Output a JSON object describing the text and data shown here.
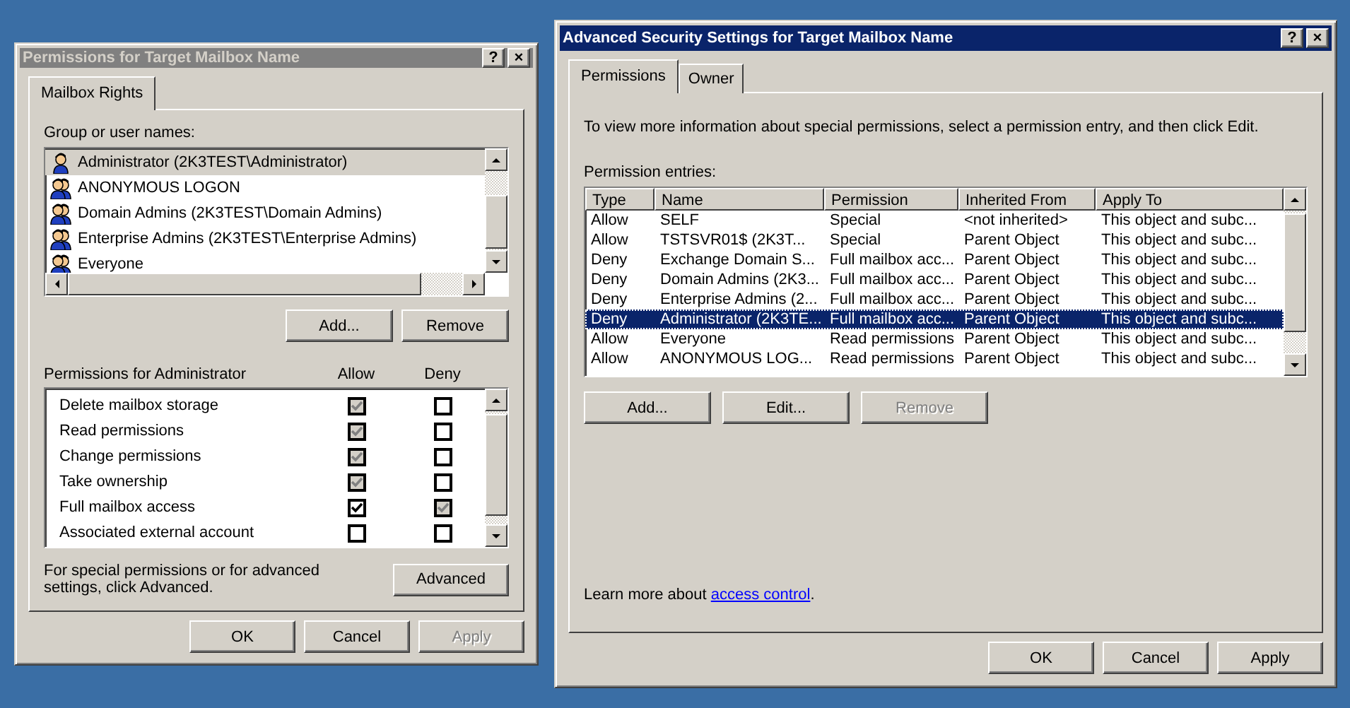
{
  "permissions_window": {
    "title": "Permissions for Target Mailbox Name",
    "active": false,
    "title_buttons": [
      "?",
      "×"
    ],
    "tabs": [
      {
        "label": "Mailbox Rights",
        "selected": true
      }
    ],
    "group_label": "Group or user names:",
    "users": [
      {
        "name": "Administrator (2K3TEST\\Administrator)",
        "kind": "user",
        "selected": true
      },
      {
        "name": "ANONYMOUS LOGON",
        "kind": "group",
        "selected": false
      },
      {
        "name": "Domain Admins (2K3TEST\\Domain Admins)",
        "kind": "group",
        "selected": false
      },
      {
        "name": "Enterprise Admins (2K3TEST\\Enterprise Admins)",
        "kind": "group",
        "selected": false
      },
      {
        "name": "Everyone",
        "kind": "group",
        "selected": false
      }
    ],
    "user_buttons": [
      {
        "label": "Add...",
        "disabled": false
      },
      {
        "label": "Remove",
        "disabled": false
      }
    ],
    "permissions_label": "Permissions for Administrator",
    "allow_header": "Allow",
    "deny_header": "Deny",
    "permissions": [
      {
        "name": "Delete mailbox storage",
        "allow": {
          "checked": true,
          "disabled": true
        },
        "deny": {
          "checked": false,
          "disabled": false
        }
      },
      {
        "name": "Read permissions",
        "allow": {
          "checked": true,
          "disabled": true
        },
        "deny": {
          "checked": false,
          "disabled": false
        }
      },
      {
        "name": "Change permissions",
        "allow": {
          "checked": true,
          "disabled": true
        },
        "deny": {
          "checked": false,
          "disabled": false
        }
      },
      {
        "name": "Take ownership",
        "allow": {
          "checked": true,
          "disabled": true
        },
        "deny": {
          "checked": false,
          "disabled": false
        }
      },
      {
        "name": "Full mailbox access",
        "allow": {
          "checked": true,
          "disabled": false
        },
        "deny": {
          "checked": true,
          "disabled": true
        }
      },
      {
        "name": "Associated external account",
        "allow": {
          "checked": false,
          "disabled": false
        },
        "deny": {
          "checked": false,
          "disabled": false
        }
      }
    ],
    "advanced_hint": "For special permissions or for advanced settings, click Advanced.",
    "advanced_button": "Advanced",
    "buttons": [
      {
        "label": "OK",
        "disabled": false
      },
      {
        "label": "Cancel",
        "disabled": false
      },
      {
        "label": "Apply",
        "disabled": true
      }
    ]
  },
  "advanced_window": {
    "title": "Advanced Security Settings for Target Mailbox Name",
    "active": true,
    "title_buttons": [
      "?",
      "×"
    ],
    "tabs": [
      {
        "label": "Permissions",
        "selected": true
      },
      {
        "label": "Owner",
        "selected": false
      }
    ],
    "intro": "To view more information about special permissions, select a permission entry, and then click Edit.",
    "entries_label": "Permission entries:",
    "columns": [
      "Type",
      "Name",
      "Permission",
      "Inherited From",
      "Apply To"
    ],
    "rows": [
      {
        "cells": [
          "Allow",
          "SELF",
          "Special",
          "<not inherited>",
          "This object and subc..."
        ],
        "selected": false
      },
      {
        "cells": [
          "Allow",
          "TSTSVR01$ (2K3T...",
          "Special",
          "Parent Object",
          "This object and subc..."
        ],
        "selected": false
      },
      {
        "cells": [
          "Deny",
          "Exchange Domain S...",
          "Full mailbox acc...",
          "Parent Object",
          "This object and subc..."
        ],
        "selected": false
      },
      {
        "cells": [
          "Deny",
          "Domain Admins (2K3...",
          "Full mailbox acc...",
          "Parent Object",
          "This object and subc..."
        ],
        "selected": false
      },
      {
        "cells": [
          "Deny",
          "Enterprise Admins (2...",
          "Full mailbox acc...",
          "Parent Object",
          "This object and subc..."
        ],
        "selected": false
      },
      {
        "cells": [
          "Deny",
          "Administrator (2K3TE...",
          "Full mailbox acc...",
          "Parent Object",
          "This object and subc..."
        ],
        "selected": true
      },
      {
        "cells": [
          "Allow",
          "Everyone",
          "Read permissions",
          "Parent Object",
          "This object and subc..."
        ],
        "selected": false
      },
      {
        "cells": [
          "Allow",
          "ANONYMOUS LOG...",
          "Read permissions",
          "Parent Object",
          "This object and subc..."
        ],
        "selected": false
      }
    ],
    "entry_buttons": [
      {
        "label": "Add...",
        "disabled": false
      },
      {
        "label": "Edit...",
        "disabled": false
      },
      {
        "label": "Remove",
        "disabled": true
      }
    ],
    "learn_more": {
      "before": "Learn more about ",
      "link": "access control",
      "after": "."
    },
    "buttons": [
      {
        "label": "OK",
        "disabled": false
      },
      {
        "label": "Cancel",
        "disabled": false
      },
      {
        "label": "Apply",
        "disabled": false
      }
    ]
  }
}
